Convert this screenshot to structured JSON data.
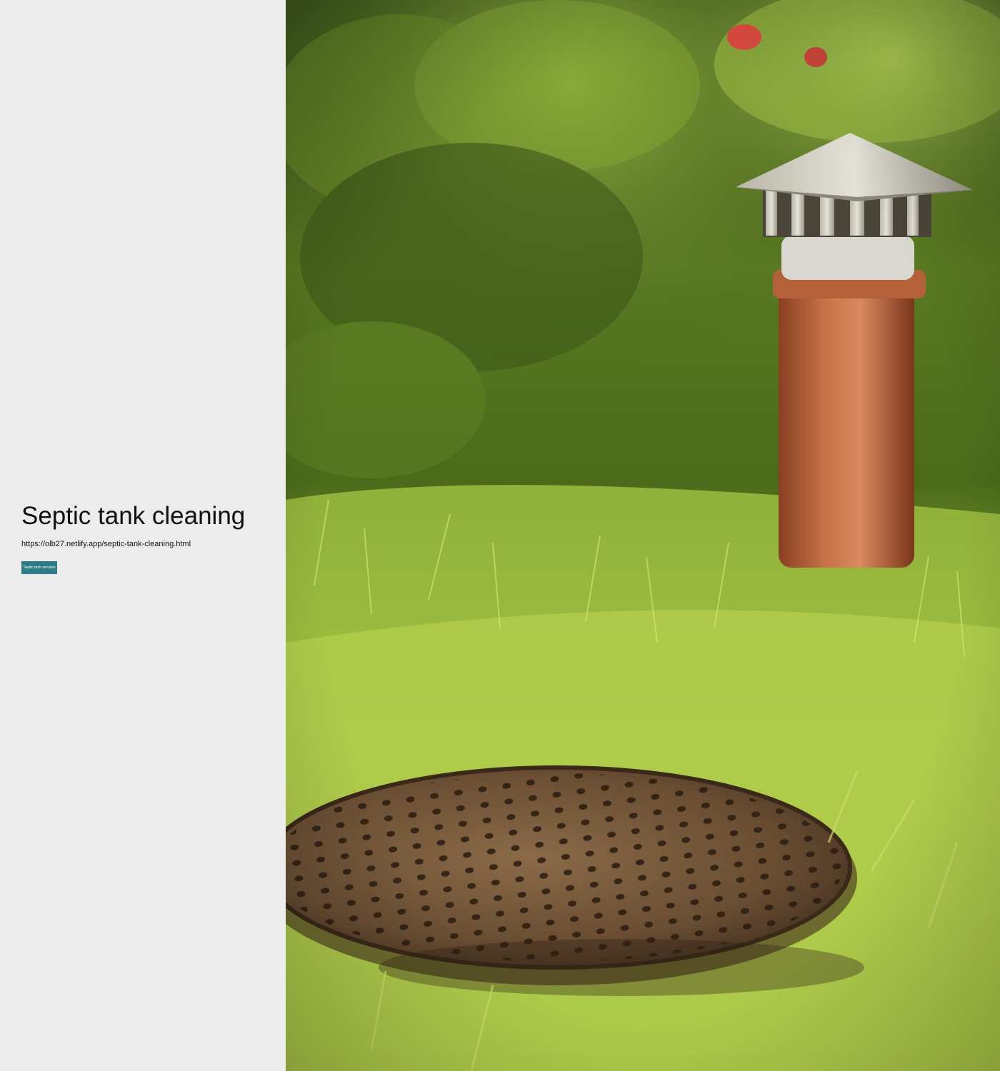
{
  "hero": {
    "title": "Septic tank cleaning",
    "url": "https://olb27.netlify.app/septic-tank-cleaning.html",
    "button_label": "Septic tank services"
  },
  "colors": {
    "left_background": "#ececed",
    "button_background": "#2f7b87",
    "button_text": "#ffffff"
  }
}
